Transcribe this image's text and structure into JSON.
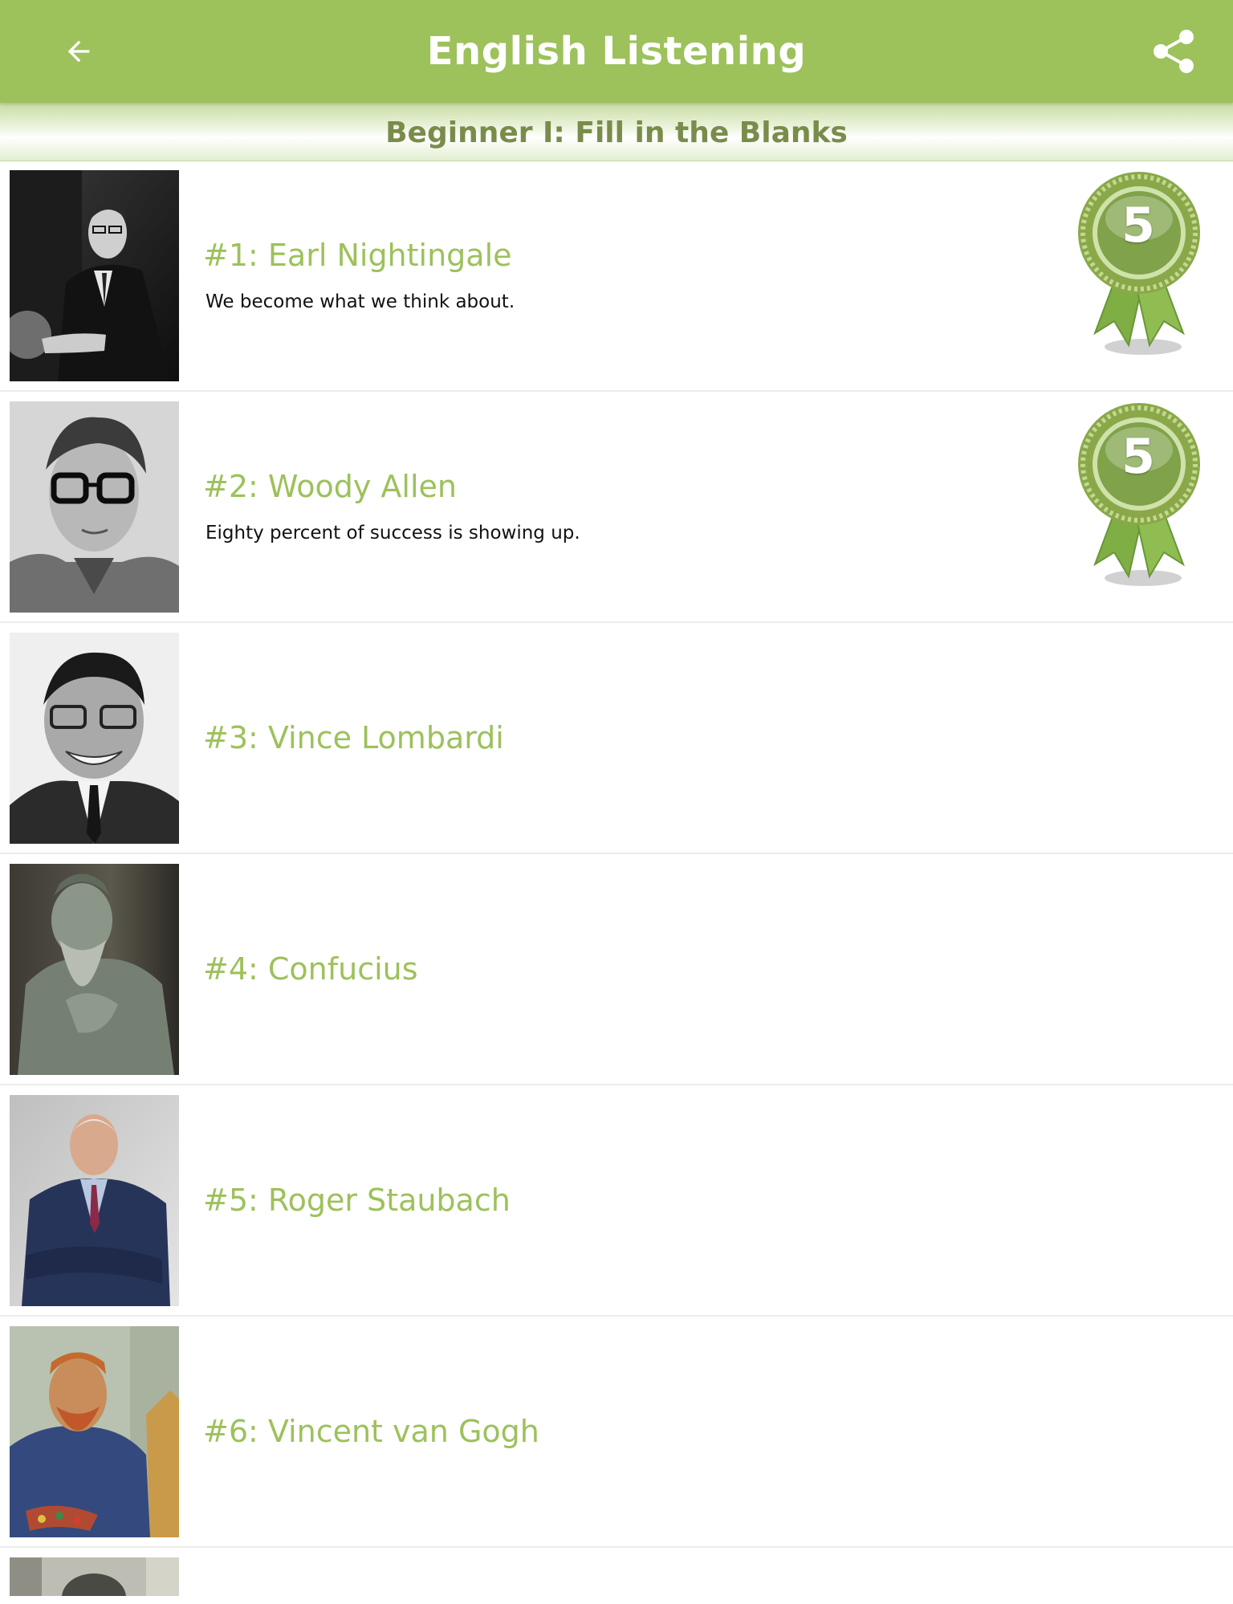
{
  "app_bar": {
    "title": "English Listening",
    "back_icon": "arrow-left-icon",
    "share_icon": "share-icon"
  },
  "level": {
    "title": "Beginner I: Fill in the Blanks"
  },
  "colors": {
    "brand_green": "#9dc15b",
    "level_text": "#7a8c4a",
    "row_divider": "#ececec"
  },
  "lessons": [
    {
      "title": "#1: Earl Nightingale",
      "quote": "We become what we think about.",
      "score": "5",
      "portrait": "earl-nightingale-portrait"
    },
    {
      "title": "#2: Woody Allen",
      "quote": "Eighty percent of success is showing up.",
      "score": "5",
      "portrait": "woody-allen-portrait"
    },
    {
      "title": "#3: Vince Lombardi",
      "quote": "",
      "score": "",
      "portrait": "vince-lombardi-portrait"
    },
    {
      "title": "#4: Confucius",
      "quote": "",
      "score": "",
      "portrait": "confucius-statue-portrait"
    },
    {
      "title": "#5: Roger Staubach",
      "quote": "",
      "score": "",
      "portrait": "roger-staubach-portrait"
    },
    {
      "title": "#6: Vincent van Gogh",
      "quote": "",
      "score": "",
      "portrait": "vincent-van-gogh-portrait"
    }
  ]
}
